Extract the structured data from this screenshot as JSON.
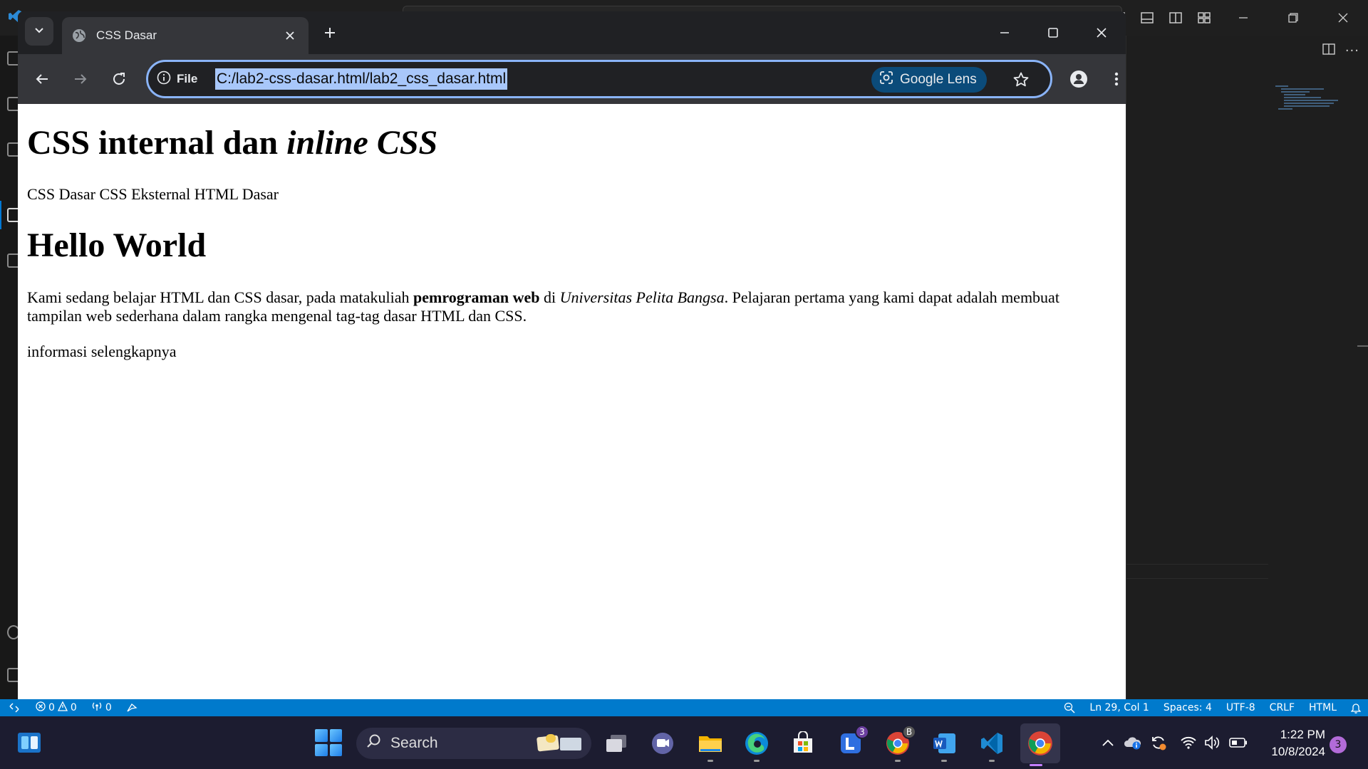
{
  "vscode": {
    "statusbar": {
      "errors": "0",
      "warnings": "0",
      "ports": "0",
      "cursor": "Ln 29, Col 1",
      "spaces": "Spaces: 4",
      "encoding": "UTF-8",
      "eol": "CRLF",
      "language": "HTML"
    }
  },
  "browser": {
    "tab": {
      "title": "CSS Dasar"
    },
    "omnibox": {
      "scheme_label": "File",
      "url": "C:/lab2-css-dasar.html/lab2_css_dasar.html",
      "lens_label": "Google Lens"
    }
  },
  "page": {
    "h1_plain": "CSS internal dan ",
    "h1_italic": "inline CSS",
    "nav": [
      "CSS Dasar",
      "CSS Eksternal",
      "HTML Dasar"
    ],
    "h2": "Hello World",
    "intro": {
      "part1": "Kami sedang belajar HTML dan CSS dasar, pada matakuliah ",
      "bold": "pemrograman web",
      "part2": " di ",
      "italic": "Universitas Pelita Bangsa",
      "part3": ". Pelajaran pertama yang kami dapat adalah membuat tampilan web sederhana dalam rangka mengenal tag-tag dasar HTML dan CSS."
    },
    "more": "informasi selengkapnya"
  },
  "taskbar": {
    "search_label": "Search",
    "teams_badge": "3",
    "chrome_profile_badge": "B",
    "time": "1:22 PM",
    "date": "10/8/2024",
    "notification_count": "3"
  },
  "colors": {
    "vscode_statusbar": "#007acc",
    "chrome_frame": "#202124",
    "chrome_toolbar": "#35363a",
    "omnibox_focus": "#8ab4f8",
    "url_selection": "#a8c7fa",
    "taskbar": "#1c1c30"
  }
}
